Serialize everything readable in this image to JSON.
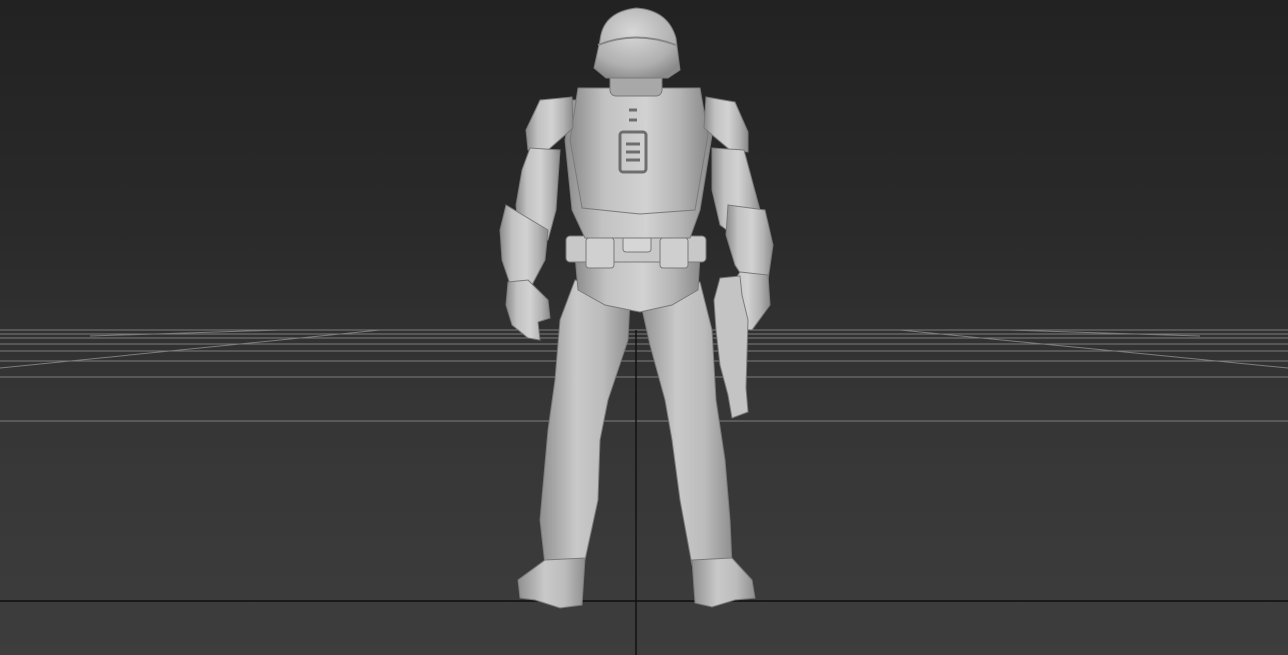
{
  "viewport": {
    "view": "back",
    "shading": "smooth",
    "background_top": "#222222",
    "background_bottom": "#3d3d3d",
    "grid_color": "#8a8a8a",
    "axis_color": "#0f0f0f",
    "model_color": "#bdbdbd"
  },
  "model": {
    "subject": "armored-soldier-figure",
    "pose": "standing",
    "prop": "pistol-in-left-hand"
  }
}
